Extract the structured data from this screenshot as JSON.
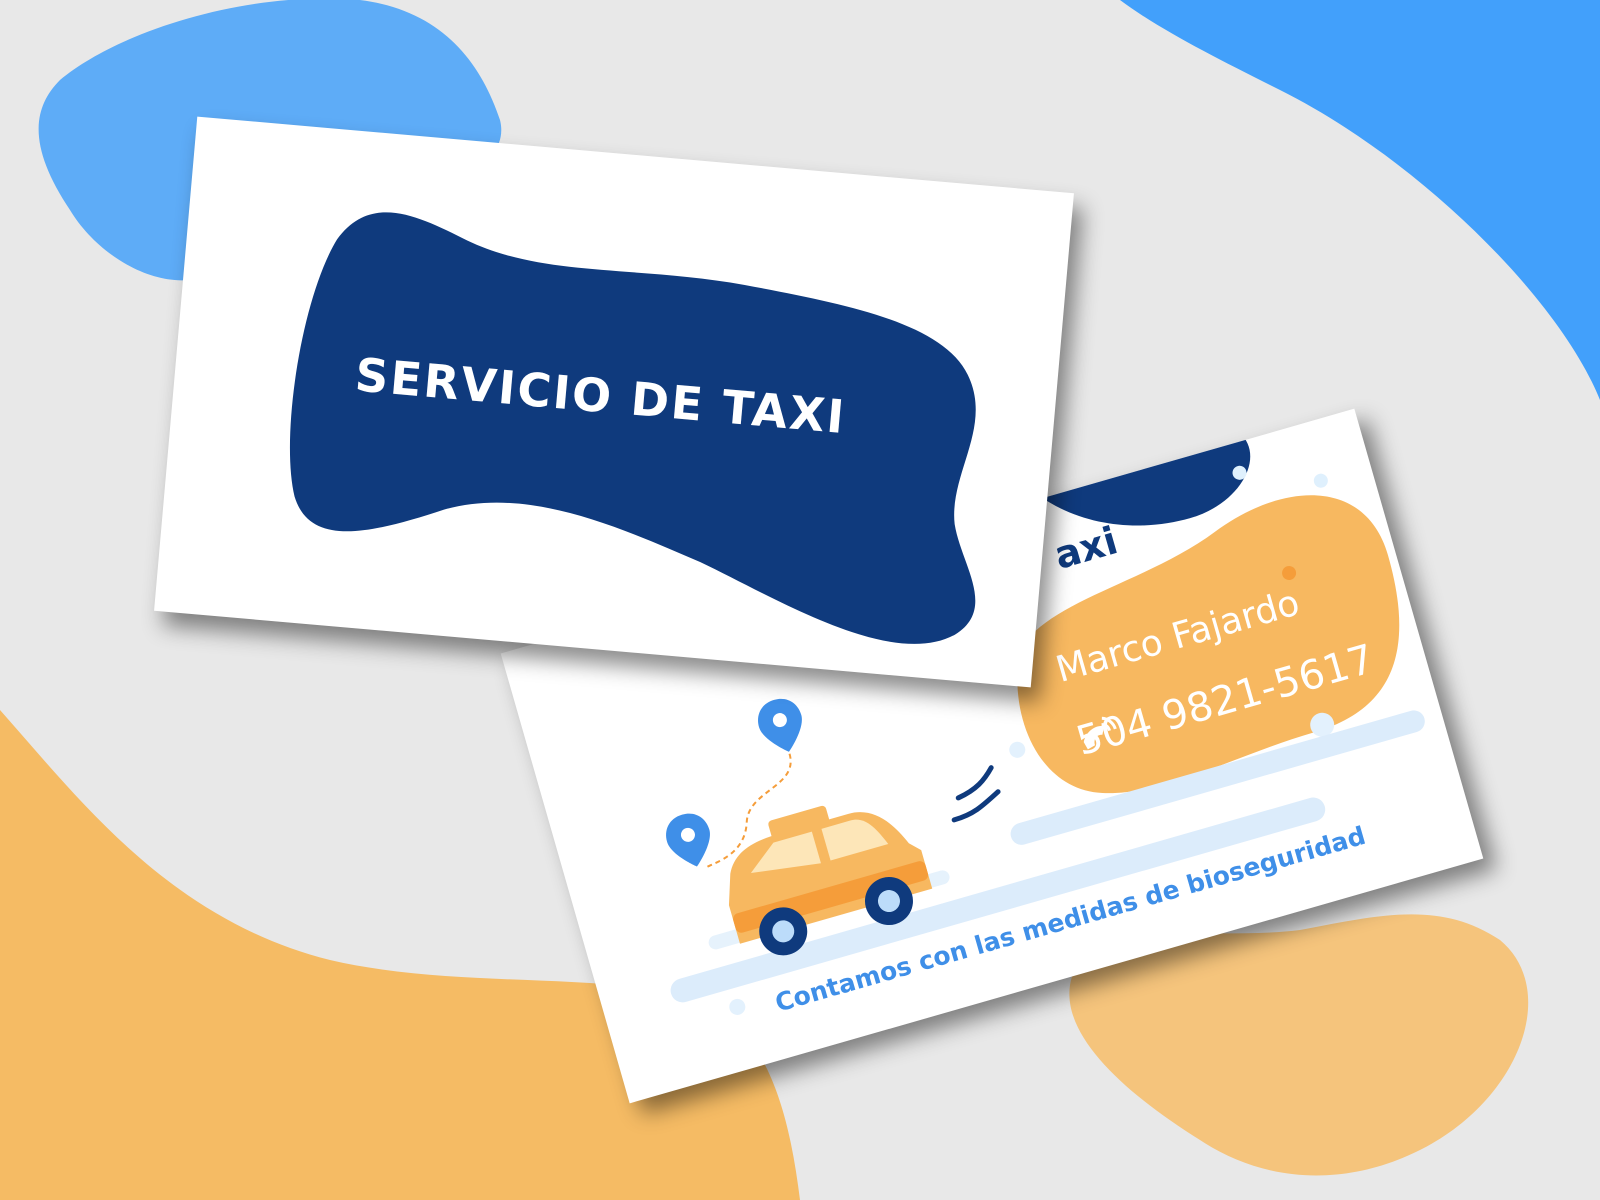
{
  "front_card": {
    "title": "SERVICIO DE TAXI",
    "blob_color": "#0f3a7d"
  },
  "back_card": {
    "title_fragment": "axi",
    "name": "Marco Fajardo",
    "phone": "504 9821-5617",
    "phone_icon": "phone-icon",
    "tagline": "Contamos con las medidas de bioseguridad",
    "blob_color": "#f7b860",
    "accent_color": "#3f8fe8"
  },
  "background": {
    "colors": {
      "gray": "#e8e8e8",
      "blue": "#42a0fb",
      "light_blue": "#5eacf7",
      "orange": "#f5bb64"
    }
  }
}
